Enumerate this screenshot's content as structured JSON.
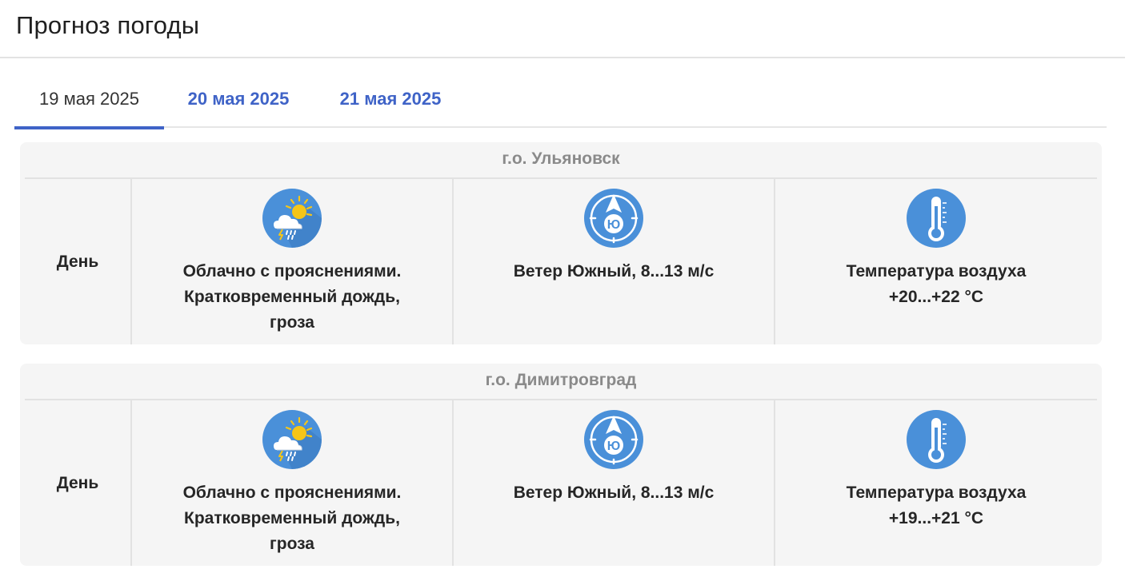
{
  "header": {
    "title": "Прогноз погоды"
  },
  "tabs": [
    {
      "label": "19 мая 2025",
      "active": true
    },
    {
      "label": "20 мая 2025",
      "active": false
    },
    {
      "label": "21 мая 2025",
      "active": false
    }
  ],
  "colors": {
    "accent": "#3f63c7",
    "icon_bg": "#4a90d9",
    "card_bg": "#f5f5f5"
  },
  "forecasts": [
    {
      "location": "г.о. Ульяновск",
      "period": "День",
      "condition": {
        "icon": "cloud-sun-rain-thunder-icon",
        "line1": "Облачно с прояснениями.",
        "line2": "Кратковременный дождь,",
        "line3": "гроза"
      },
      "wind": {
        "icon": "wind-south-compass-icon",
        "direction_letter": "Ю",
        "text": "Ветер Южный, 8...13 м/с"
      },
      "temperature": {
        "icon": "thermometer-icon",
        "label": "Температура воздуха",
        "value": "+20...+22 °C"
      }
    },
    {
      "location": "г.о. Димитровград",
      "period": "День",
      "condition": {
        "icon": "cloud-sun-rain-thunder-icon",
        "line1": "Облачно с прояснениями.",
        "line2": "Кратковременный дождь,",
        "line3": "гроза"
      },
      "wind": {
        "icon": "wind-south-compass-icon",
        "direction_letter": "Ю",
        "text": "Ветер Южный, 8...13 м/с"
      },
      "temperature": {
        "icon": "thermometer-icon",
        "label": "Температура воздуха",
        "value": "+19...+21 °C"
      }
    }
  ]
}
